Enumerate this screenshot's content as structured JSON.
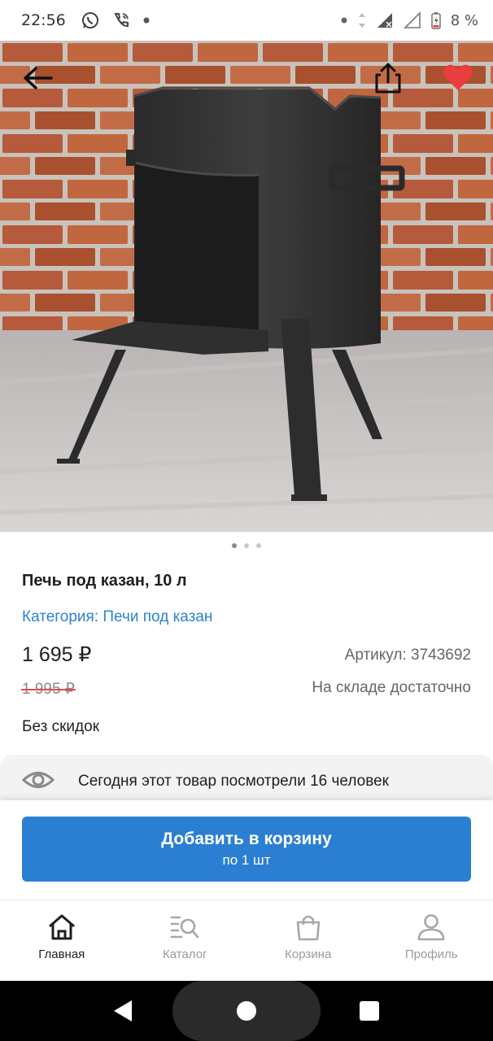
{
  "status_bar": {
    "time": "22:56",
    "battery_percent": "8 %",
    "icons": [
      "whatsapp-icon",
      "phone-call-icon",
      "notification-dot-icon",
      "signal-icon",
      "battery-icon"
    ]
  },
  "hero": {
    "back_icon": "arrow-left-icon",
    "share_icon": "share-icon",
    "favorite_icon": "heart-icon",
    "favorite_color": "#e83e3e",
    "page_count": 3,
    "active_page": 1
  },
  "product": {
    "title": "Печь под казан, 10 л",
    "category": "Категория: Печи под казан",
    "price": "1 695 ₽",
    "article": "Артикул: 3743692",
    "old_price": "1 995 ₽",
    "stock": "На складе достаточно",
    "discount": "Без скидок"
  },
  "views": {
    "icon": "eye-icon",
    "text": "Сегодня этот товар посмотрели 16 человек"
  },
  "cart_button": {
    "label": "Добавить в корзину",
    "sublabel": "по 1 шт",
    "color": "#2b7fd3"
  },
  "tabs": [
    {
      "label": "Главная",
      "icon": "home-icon",
      "active": true
    },
    {
      "label": "Каталог",
      "icon": "catalog-search-icon",
      "active": false
    },
    {
      "label": "Корзина",
      "icon": "shopping-bag-icon",
      "active": false
    },
    {
      "label": "Профиль",
      "icon": "profile-icon",
      "active": false
    }
  ],
  "nav": {
    "back": "triangle-back-icon",
    "home": "home-circle-icon",
    "recent": "square-recent-icon"
  }
}
